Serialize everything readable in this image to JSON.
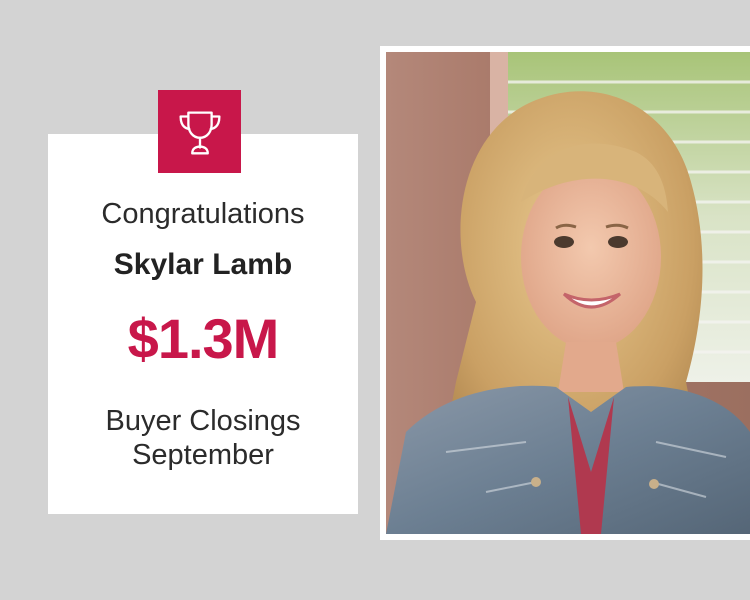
{
  "award": {
    "congrats_text": "Congratulations",
    "agent_name": "Skylar Lamb",
    "amount": "$1.3M",
    "category": "Buyer Closings",
    "month": "September"
  },
  "colors": {
    "background": "#d3d3d3",
    "accent": "#c8174a",
    "card": "#ffffff",
    "text": "#2b2b2b"
  },
  "icons": {
    "badge_icon": "trophy-icon"
  },
  "photo": {
    "subject": "headshot-photo"
  }
}
